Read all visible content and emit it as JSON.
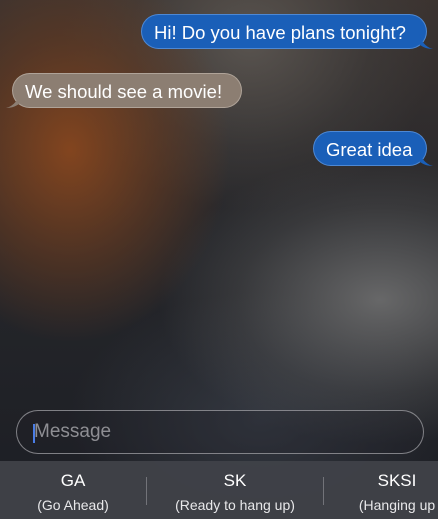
{
  "thread": {
    "messages": [
      {
        "direction": "outgoing",
        "text": "Hi! Do you have plans tonight?"
      },
      {
        "direction": "incoming",
        "text": "We should see a movie!"
      },
      {
        "direction": "outgoing",
        "text": "Great idea"
      }
    ]
  },
  "compose": {
    "placeholder": "Message",
    "value": ""
  },
  "suggestions": [
    {
      "code": "GA",
      "description": "(Go Ahead)"
    },
    {
      "code": "SK",
      "description": "(Ready to hang up)"
    },
    {
      "code": "SKSI",
      "description": "(Hanging up"
    }
  ],
  "colors": {
    "outgoing_bubble": "#1a5fb8",
    "incoming_bubble": "#8c7e72",
    "caret": "#4a7de6",
    "placeholder": "#8e8e93",
    "suggestion_bar": "#404248"
  }
}
